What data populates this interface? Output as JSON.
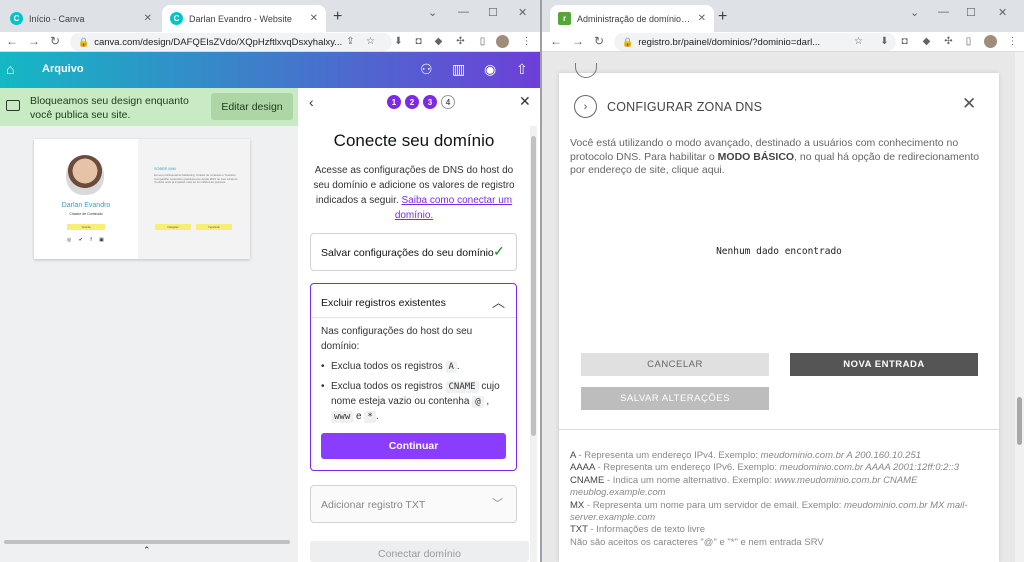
{
  "left_window": {
    "tabs": [
      {
        "title": "Início - Canva"
      },
      {
        "title": "Darlan Evandro - Website"
      }
    ],
    "url": "canva.com/design/DAFQEIsZVdo/XQpHzftlxvqDsxyhalxy...",
    "canva_header": {
      "menu_label": "Arquivo"
    },
    "banner": {
      "text": "Bloqueamos seu design enquanto você publica seu site.",
      "button": "Editar design"
    },
    "design_preview": {
      "name": "Darlan Evandro",
      "role": "Criador de Conteúdo",
      "heading": "SOBRE MIM",
      "paragraph": "Eu sou profissional de Marketing, Criador de conteúdo e Youtuber. Compartilho conteúdos gratuitamente desde 2015 no meu canal do Youtube onde já impactei mais de 1k milhões de pessoas.",
      "buttons": [
        "Youtube",
        "Instagram",
        "Facebook"
      ]
    },
    "panel": {
      "steps": [
        "1",
        "2",
        "3",
        "4"
      ],
      "title": "Conecte seu domínio",
      "desc": "Acesse as configurações de DNS do host do seu domínio e adicione os valores de registro indicados a seguir. ",
      "desc_link": "Saiba como conectar um domínio.",
      "section1": "Salvar configurações do seu domínio",
      "section2": {
        "title": "Excluir registros existentes",
        "intro": "Nas configurações do host do seu domínio:",
        "bullet1_pre": "Exclua todos os registros ",
        "bullet1_code": "A",
        "bullet1_post": ".",
        "bullet2_pre": "Exclua todos os registros ",
        "bullet2_code1": "CNAME",
        "bullet2_mid": " cujo nome esteja vazio ou contenha ",
        "bullet2_code2": "@",
        "bullet2_sep": " , ",
        "bullet2_code3": "www",
        "bullet2_and": " e ",
        "bullet2_code4": "*",
        "bullet2_end": ".",
        "button": "Continuar"
      },
      "section3": "Adicionar registro TXT",
      "bottom_button": "Conectar domínio"
    }
  },
  "right_window": {
    "tab_title": "Administração de domínio - Reg",
    "url": "registro.br/painel/dominios/?dominio=darl...",
    "modal": {
      "title": "CONFIGURAR ZONA DNS",
      "info_pre": "Você está utilizando o modo avançado, destinado a usuários com conhecimento no protocolo DNS. Para habilitar o ",
      "info_bold": "MODO BÁSICO",
      "info_post": ", no qual há opção de redirecionamento por endereço de site, clique aqui.",
      "empty": "Nenhum dado encontrado",
      "buttons": {
        "cancel": "CANCELAR",
        "new": "NOVA ENTRADA",
        "save": "SALVAR ALTERAÇÕES"
      },
      "legend": [
        {
          "key": "A",
          "text": " - Representa um endereço IPv4. Exemplo: ",
          "example": "meudominio.com.br A 200.160.10.251"
        },
        {
          "key": "AAAA",
          "text": " - Representa um endereço IPv6. Exemplo: ",
          "example": "meudominio.com.br AAAA 2001:12ff:0:2::3"
        },
        {
          "key": "CNAME",
          "text": " - Indica um nome alternativo. Exemplo: ",
          "example": "www.meudominio.com.br CNAME meublog.example.com"
        },
        {
          "key": "MX",
          "text": " - Representa um nome para um servidor de email. Exemplo: ",
          "example": "meudominio.com.br MX mail-server.example.com"
        },
        {
          "key": "TXT",
          "text": " - Informações de texto livre",
          "example": ""
        }
      ],
      "legend_note": "Não são aceitos os caracteres \"@\" e \"*\" e nem entrada SRV"
    }
  }
}
